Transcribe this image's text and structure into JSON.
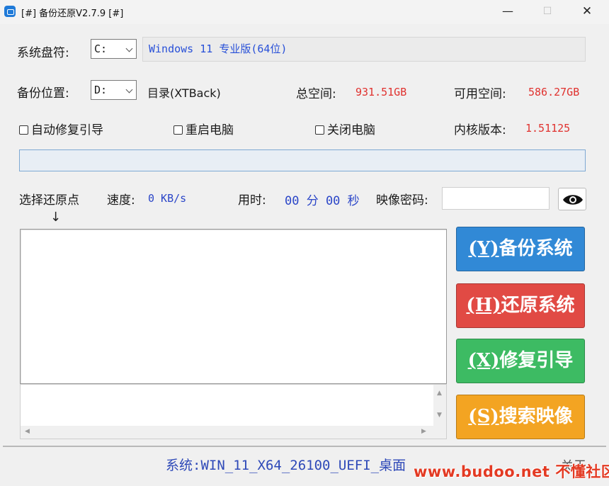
{
  "window": {
    "title": "[#] 备份还原V2.7.9 [#]",
    "minimize": "—",
    "maximize": "☐",
    "close": "✕"
  },
  "system_drive": {
    "label": "系统盘符:",
    "value": "C:",
    "os_info": "Windows 11 专业版(64位)"
  },
  "backup_location": {
    "label": "备份位置:",
    "value": "D:",
    "directory": "目录(XTBack)",
    "total_label": "总空间:",
    "total_value": "931.51GB",
    "free_label": "可用空间:",
    "free_value": "586.27GB"
  },
  "options": {
    "auto_repair_boot": "自动修复引导",
    "restart_pc": "重启电脑",
    "shutdown_pc": "关闭电脑",
    "kernel_label": "内核版本:",
    "kernel_value": "1.51125"
  },
  "progress": {
    "value": 0
  },
  "info_row": {
    "restore_point_label": "选择还原点",
    "speed_label": "速度:",
    "speed_value": "0 KB/s",
    "time_label": "用时:",
    "time_value": "00 分 00 秒",
    "image_password_label": "映像密码:",
    "image_password_value": "",
    "arrow": "↓"
  },
  "actions": {
    "backup": {
      "key": "(Y)",
      "text": "备份系统",
      "color": "#3189d6"
    },
    "restore": {
      "key": "(H)",
      "text": "还原系统",
      "color": "#e14a44"
    },
    "repair": {
      "key": "(X)",
      "text": "修复引导",
      "color": "#3dbb63"
    },
    "search": {
      "key": "(S)",
      "text": "搜索映像",
      "color": "#f3a422"
    }
  },
  "status_bar": {
    "system": "系统:WIN_11_X64_26100_UEFI_桌面",
    "about": "关于",
    "watermark": "www.budoo.net 不懂社区"
  }
}
